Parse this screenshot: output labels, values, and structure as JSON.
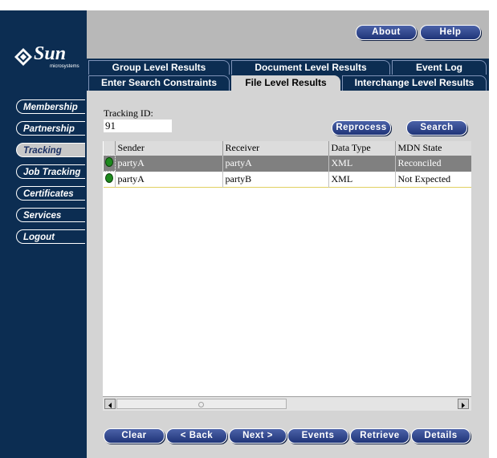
{
  "brand": {
    "logo_text": "Sun",
    "logo_sub": "microsystems"
  },
  "header": {
    "about_label": "About",
    "help_label": "Help"
  },
  "tabs_row1": [
    "Group Level Results",
    "Document Level Results",
    "Event Log"
  ],
  "tabs_row2": [
    "Enter Search Constraints",
    "File Level Results",
    "Interchange Level Results"
  ],
  "active_tab": "File Level Results",
  "nav": [
    "Membership",
    "Partnership",
    "Tracking",
    "Job Tracking",
    "Certificates",
    "Services",
    "Logout"
  ],
  "active_nav": "Tracking",
  "tracking": {
    "label": "Tracking ID:",
    "value": "91"
  },
  "actions": {
    "reprocess_label": "Reprocess",
    "search_label": "Search"
  },
  "grid": {
    "columns": [
      "Sender",
      "Receiver",
      "Data Type",
      "MDN State"
    ],
    "rows": [
      {
        "sender": "partyA",
        "receiver": "partyA",
        "data_type": "XML",
        "mdn_state": "Reconciled",
        "selected": true
      },
      {
        "sender": "partyA",
        "receiver": "partyB",
        "data_type": "XML",
        "mdn_state": "Not Expected",
        "selected": false
      }
    ]
  },
  "footer": {
    "buttons": [
      "Clear",
      "< Back",
      "Next >",
      "Events",
      "Retrieve",
      "Details"
    ]
  },
  "colors": {
    "navy": "#0c2d52",
    "button": "#2d438a",
    "selected_row": "#808080",
    "status_dot": "#1d8a1d"
  }
}
